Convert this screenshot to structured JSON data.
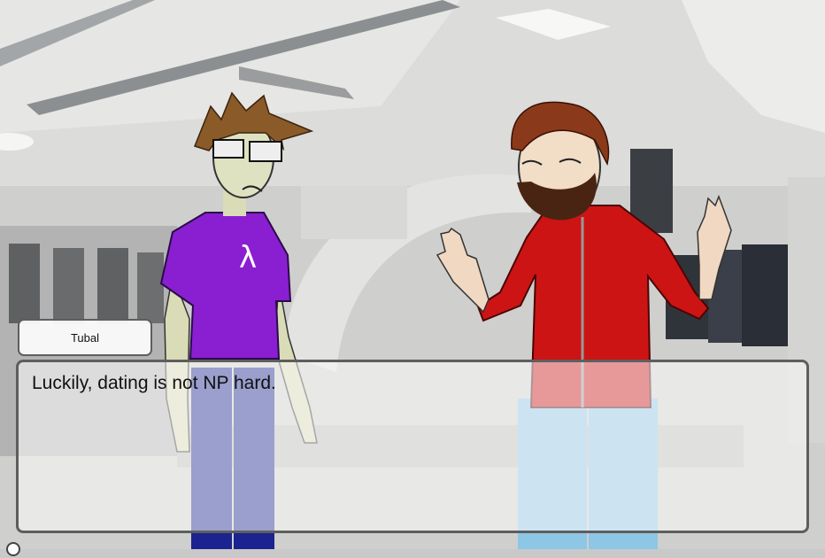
{
  "speaker": {
    "name": "Tubal"
  },
  "dialogue": {
    "text": "Luckily, dating is not NP hard."
  },
  "characters": [
    {
      "shirt_symbol": "λ",
      "shirt_color": "#8a1fd1",
      "pants_color": "#1a238f"
    },
    {
      "hoodie_color": "#cc1414",
      "pants_color": "#8ec6e6"
    }
  ],
  "colors": {
    "textbox_border": "#5e5e5e",
    "namebox_bg": "#fcfcfc"
  }
}
